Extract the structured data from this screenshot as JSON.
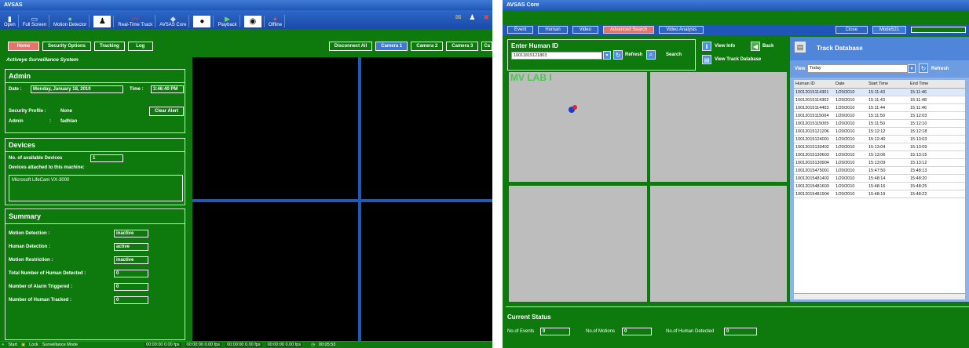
{
  "left": {
    "title": "AVSAS",
    "toolbar": [
      {
        "label": "Open",
        "icon": "open-icon",
        "glyph": "▮",
        "cls": "w"
      },
      {
        "label": "Full Screen",
        "icon": "fullscreen-icon",
        "glyph": "▭",
        "cls": "b"
      },
      {
        "label": "Motion Detector",
        "icon": "motion-icon",
        "glyph": "●",
        "cls": "g"
      },
      {
        "label": "",
        "icon": "person-icon",
        "glyph": "♟",
        "cls": "box"
      },
      {
        "label": "Real-Time Track",
        "icon": "track-icon",
        "glyph": "〰",
        "cls": "r"
      },
      {
        "label": "AVSAS Core",
        "icon": "core-icon",
        "glyph": "◆",
        "cls": "b"
      },
      {
        "label": "",
        "icon": "camera-icon",
        "glyph": "●",
        "cls": "box"
      },
      {
        "label": "Playback",
        "icon": "play-icon",
        "glyph": "▶",
        "cls": "g"
      },
      {
        "label": "",
        "icon": "eye-icon",
        "glyph": "◉",
        "cls": "box"
      },
      {
        "label": "Offline",
        "icon": "offline-icon",
        "glyph": "●",
        "cls": "r"
      }
    ],
    "nav": {
      "home": "Home",
      "security": "Security Options",
      "tracking": "Tracking",
      "log": "Log",
      "disconnect": "Disconnect All",
      "cam1": "Camera 1",
      "cam2": "Camera 2",
      "cam3": "Camera 3",
      "cam4": "Ca"
    },
    "system_name": "Activeye Surveillance System",
    "admin": {
      "header": "Admin",
      "date_label": "Date :",
      "date": "Monday, January 18, 2010",
      "time_label": "Time :",
      "time": "3:46:40 PM",
      "profile_label": "Security Profile :",
      "profile": "None",
      "admin_label": "Admin",
      "admin_sep": ":",
      "admin_name": "fadhlan",
      "clear_alert": "Clear Alert"
    },
    "devices": {
      "header": "Devices",
      "available_label": "No. of available Devices",
      "available": "1",
      "attached_label": "Devices attached to this machine:",
      "device": "Microsoft LifeCam VX-3000"
    },
    "summary": {
      "header": "Summary",
      "rows": [
        {
          "label": "Motion Detection :",
          "value": "inactive"
        },
        {
          "label": "Human Detection :",
          "value": "active"
        },
        {
          "label": "Motion Restriction :",
          "value": "inactive"
        },
        {
          "label": "Total Number of Human Detected :",
          "value": "0"
        },
        {
          "label": "Number of Alarm Triggered :",
          "value": "0"
        },
        {
          "label": "Number of Human Tracked :",
          "value": "0"
        }
      ]
    },
    "status": {
      "start": "Start",
      "lock": "Lock",
      "mode": "Surveillance Mode",
      "cams": [
        "00:00:00  0.00 fps",
        "00:00:00  0.00 fps",
        "00:00:00  0.00 fps",
        "00:00:00  0.00 fps"
      ],
      "clock": "00:05:53"
    }
  },
  "right": {
    "title": "AVSAS Core",
    "tabs": [
      "Event",
      "Human",
      "Video",
      "Advanced Search",
      "Video Analysis"
    ],
    "close": "Close",
    "modes": "Mode521",
    "enter_id": {
      "header": "Enter Human ID",
      "value": "10011815121803",
      "refresh": "Refresh",
      "search": "Search",
      "view_info": "View Info",
      "back": "Back",
      "view_track": "View Track Database"
    },
    "lab_label": "MV LAB I",
    "track": {
      "header": "Track Database",
      "view_label": "View",
      "view_value": "Today",
      "refresh": "Refresh",
      "columns": [
        "Human ID",
        "Date",
        "Start Time",
        "End Time"
      ],
      "rows": [
        [
          "10012015114301",
          "1/20/2010",
          "15:11:43",
          "15:11:46"
        ],
        [
          "10012015114302",
          "1/20/2010",
          "15:11:43",
          "15:11:48"
        ],
        [
          "10012015114403",
          "1/20/2010",
          "15:11:44",
          "15:11:46"
        ],
        [
          "10012015115004",
          "1/20/2010",
          "15:11:50",
          "15:12:03"
        ],
        [
          "10012015115005",
          "1/20/2010",
          "15:11:50",
          "15:12:10"
        ],
        [
          "10012015121206",
          "1/20/2010",
          "15:12:12",
          "15:12:18"
        ],
        [
          "10012015124001",
          "1/20/2010",
          "15:12:40",
          "15:13:03"
        ],
        [
          "10012015130402",
          "1/20/2010",
          "15:13:04",
          "15:13:09"
        ],
        [
          "10012015130603",
          "1/20/2010",
          "15:13:06",
          "15:13:15"
        ],
        [
          "10012015130904",
          "1/20/2010",
          "15:13:09",
          "15:13:12"
        ],
        [
          "10012015475001",
          "1/20/2010",
          "15:47:50",
          "15:48:13"
        ],
        [
          "10012015481402",
          "1/20/2010",
          "15:48:14",
          "15:48:20"
        ],
        [
          "10012015481603",
          "1/20/2010",
          "15:48:16",
          "15:48:25"
        ],
        [
          "10012015481904",
          "1/20/2010",
          "15:48:19",
          "15:48:22"
        ]
      ]
    },
    "current_status": {
      "header": "Current Status",
      "events_label": "No.of Events",
      "events": "0",
      "motions_label": "No.of Motions",
      "motions": "0",
      "humans_label": "No.of Human Detected",
      "humans": "0"
    }
  }
}
